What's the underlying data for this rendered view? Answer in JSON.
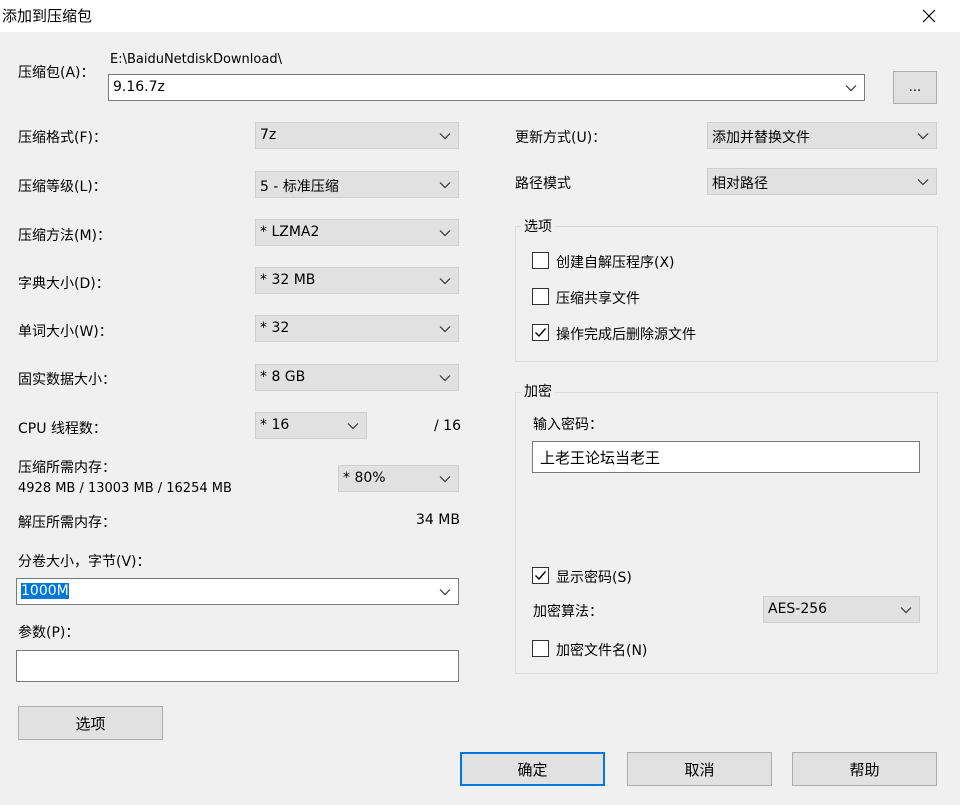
{
  "window": {
    "title": "添加到压缩包"
  },
  "archive": {
    "label": "压缩包(A)：",
    "path": "E:\\BaiduNetdiskDownload\\",
    "filename": "9.16.7z",
    "browse_label": "..."
  },
  "left": {
    "format": {
      "label": "压缩格式(F)：",
      "value": "7z"
    },
    "level": {
      "label": "压缩等级(L)：",
      "value": "5 - 标准压缩"
    },
    "method": {
      "label": "压缩方法(M)：",
      "value": "* LZMA2"
    },
    "dict": {
      "label": "字典大小(D)：",
      "value": "* 32 MB"
    },
    "word": {
      "label": "单词大小(W)：",
      "value": "* 32"
    },
    "solid": {
      "label": "固实数据大小：",
      "value": "* 8 GB"
    },
    "threads": {
      "label": "CPU 线程数：",
      "value": "* 16",
      "max": "/ 16"
    },
    "mem_compress": {
      "label": "压缩所需内存：",
      "detail": "4928 MB / 13003 MB / 16254 MB",
      "value": "* 80%"
    },
    "mem_decompress": {
      "label": "解压所需内存：",
      "value": "34 MB"
    },
    "volume": {
      "label": "分卷大小，字节(V)：",
      "value": "1000M"
    },
    "params": {
      "label": "参数(P)：",
      "value": ""
    },
    "options_button": "选项"
  },
  "right": {
    "update": {
      "label": "更新方式(U)：",
      "value": "添加并替换文件"
    },
    "pathmode": {
      "label": "路径模式",
      "value": "相对路径"
    },
    "options_group": {
      "title": "选项",
      "sfx": {
        "label": "创建自解压程序(X)",
        "checked": false
      },
      "shared": {
        "label": "压缩共享文件",
        "checked": false
      },
      "delete": {
        "label": "操作完成后删除源文件",
        "checked": true
      }
    },
    "encryption": {
      "title": "加密",
      "password_label": "输入密码：",
      "password": "上老王论坛当老王",
      "show_password": {
        "label": "显示密码(S)",
        "checked": true
      },
      "method_label": "加密算法：",
      "method": "AES-256",
      "encrypt_names": {
        "label": "加密文件名(N)",
        "checked": false
      }
    }
  },
  "buttons": {
    "ok": "确定",
    "cancel": "取消",
    "help": "帮助"
  },
  "colors": {
    "accent": "#0078d7",
    "dialog_bg": "#f0f0f0",
    "combo_bg": "#e1e1e1"
  },
  "icons": {
    "close": "close-icon",
    "dropdown": "chevron-down-icon",
    "check": "check-icon"
  }
}
